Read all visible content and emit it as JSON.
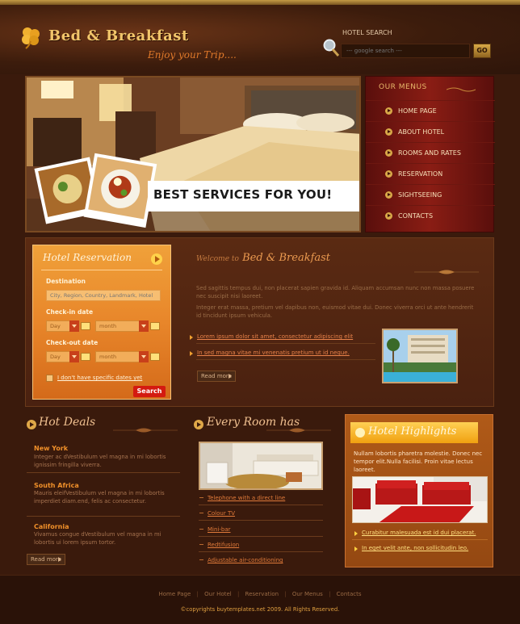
{
  "header": {
    "title": "Bed & Breakfast",
    "tagline": "Enjoy your Trip....",
    "search_label": "HOTEL SEARCH",
    "search_placeholder": "--- google search ---",
    "search_button": "GO"
  },
  "banner": {
    "caption": "BEST SERVICES FOR YOU!"
  },
  "menus": {
    "title": "OUR MENUS",
    "items": [
      {
        "label": "HOME PAGE"
      },
      {
        "label": "ABOUT HOTEL"
      },
      {
        "label": "ROOMS AND RATES"
      },
      {
        "label": "RESERVATION"
      },
      {
        "label": "SIGHTSEEING"
      },
      {
        "label": "CONTACTS"
      }
    ]
  },
  "reservation": {
    "title": "Hotel Reservation",
    "destination_label": "Destination",
    "destination_placeholder": "City, Region, Country, Landmark, Hotel",
    "checkin_label": "Check-in date",
    "checkout_label": "Check-out date",
    "day": "Day",
    "month": "month",
    "no_dates": "I don't have specific dates yet",
    "search_button": "Search"
  },
  "welcome": {
    "title_small": "Welcome to",
    "title": "Bed & Breakfast",
    "para1": "Sed sagittis tempus dui, non placerat sapien gravida id. Aliquam accumsan nunc non massa posuere nec suscipit nisi laoreet.",
    "para2": "Integer erat massa, pretium vel dapibus non, euismod vitae dui. Donec viverra orci ut ante hendrerit id tincidunt ipsum vehicula.",
    "links": [
      "Lorem ipsum dolor sit amet, consectetur adipiscing elit",
      "In sed magna vitae mi venenatis pretium ut id neque."
    ],
    "read_more": "Read more"
  },
  "hot_deals": {
    "title": "Hot Deals",
    "items": [
      {
        "name": "New York",
        "text": "Integer ac dVestibulum vel magna in mi lobortis ignissim fringilla viverra."
      },
      {
        "name": "South Africa",
        "text": "Mauris eleifVestibulum vel magna in mi lobortis imperdiet diam.end, felis ac consectetur."
      },
      {
        "name": "California",
        "text": "Vivamus congue dVestibulum vel magna in mi lobortis ui lorem ipsum tortor."
      }
    ],
    "read_more": "Read more"
  },
  "every_room": {
    "title": "Every Room has",
    "items": [
      "Telephone with a direct line",
      "Colour TV",
      "Mini-bar",
      "Redtifusion",
      "Adjustable air-conditioning"
    ]
  },
  "highlights": {
    "title": "Hotel Highlights",
    "text": "Nullam lobortis pharetra molestie. Donec nec tempor elit.Nulla facilisi. Proin vitae lectus laoreet.",
    "links": [
      "Curabitur malesuada est id dui placerat.",
      "In eget velit ante, non sollicitudin leo."
    ]
  },
  "footer": {
    "nav": [
      "Home Page",
      "Our Hotel",
      "Reservation",
      "Our Menus",
      "Contacts"
    ],
    "separator": "|",
    "copyright": "©copyrights buytemplates.net 2009. All Rights Reserved."
  }
}
